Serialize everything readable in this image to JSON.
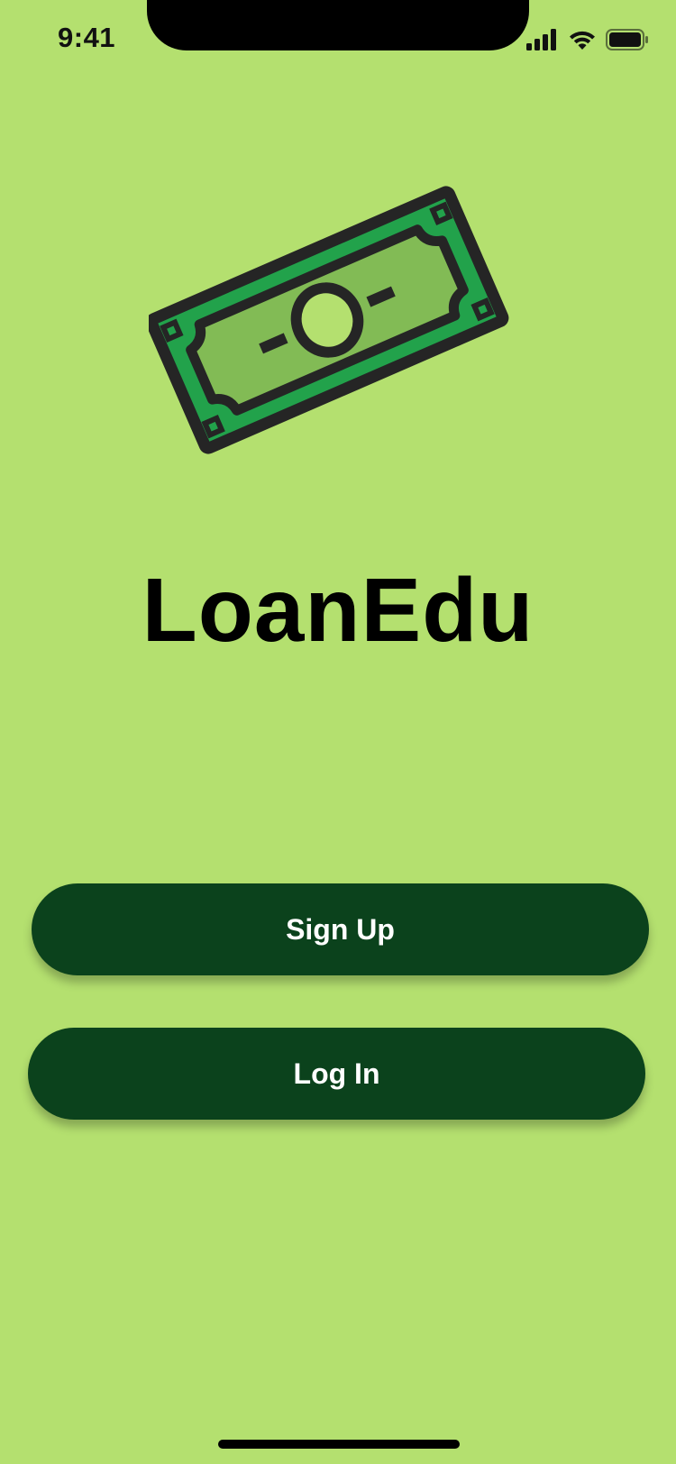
{
  "status_bar": {
    "time": "9:41",
    "icons": [
      "cellular-signal-icon",
      "wifi-icon",
      "battery-icon"
    ]
  },
  "logo": {
    "icon": "money-bill-icon",
    "colors": {
      "outline": "#252525",
      "outer": "#22a24b",
      "inner": "#82bb55"
    }
  },
  "app": {
    "title": "LoanEdu"
  },
  "actions": {
    "signup_label": "Sign Up",
    "login_label": "Log In"
  },
  "theme": {
    "background": "#b4e06f",
    "button_color": "#0b421c",
    "button_text": "#ffffff"
  }
}
